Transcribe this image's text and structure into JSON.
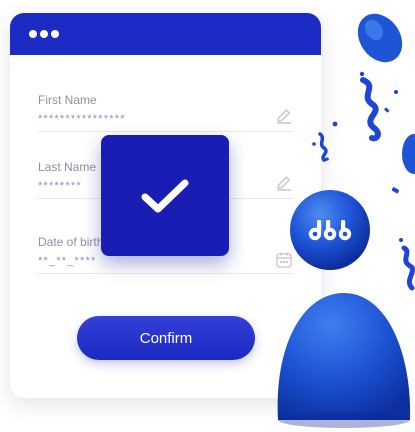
{
  "header": {
    "menu_icon": "more-dots-icon"
  },
  "form": {
    "fields": [
      {
        "label": "First Name",
        "value": "****************",
        "icon": "pencil-icon"
      },
      {
        "label": "Last Name",
        "value": "********",
        "icon": "pencil-icon"
      },
      {
        "label": "Date of birth",
        "value": "**_**_****",
        "icon": "calendar-icon"
      }
    ],
    "confirm_label": "Confirm"
  },
  "overlay": {
    "icon": "checkmark-icon"
  },
  "avatar": {
    "logo_icon": "ddb-logo-icon"
  },
  "colors": {
    "primary": "#1b2bc4",
    "accent": "#1a1db4",
    "figure": "#1e5fd8"
  }
}
